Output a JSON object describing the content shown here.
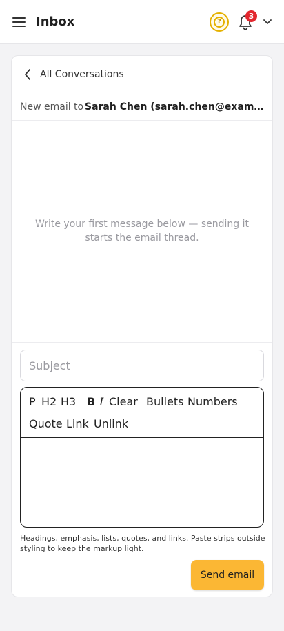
{
  "header": {
    "title": "Inbox",
    "help_icon": "question-circle-icon",
    "notifications": {
      "icon": "bell-icon",
      "count": "3"
    },
    "menu_icon": "chevron-down-icon"
  },
  "conversation": {
    "back_label": "All Conversations",
    "recipient_prefix": "New email to",
    "recipient": "Sarah Chen (sarah.chen@example.com)",
    "empty_hint": "Write your first message below — sending it starts the email thread."
  },
  "composer": {
    "subject_placeholder": "Subject",
    "toolbar": {
      "p": "P",
      "h2": "H2",
      "h3": "H3",
      "bold": "B",
      "italic": "I",
      "clear": "Clear",
      "bullets": "Bullets",
      "numbers": "Numbers",
      "quote": "Quote",
      "link": "Link",
      "unlink": "Unlink"
    },
    "help_text": "Headings, emphasis, lists, quotes, and links. Paste strips outside styling to keep the markup light.",
    "send_label": "Send email"
  },
  "colors": {
    "accent": "#fbb734",
    "badge": "#e3272e",
    "help_ring": "#e5b100"
  }
}
